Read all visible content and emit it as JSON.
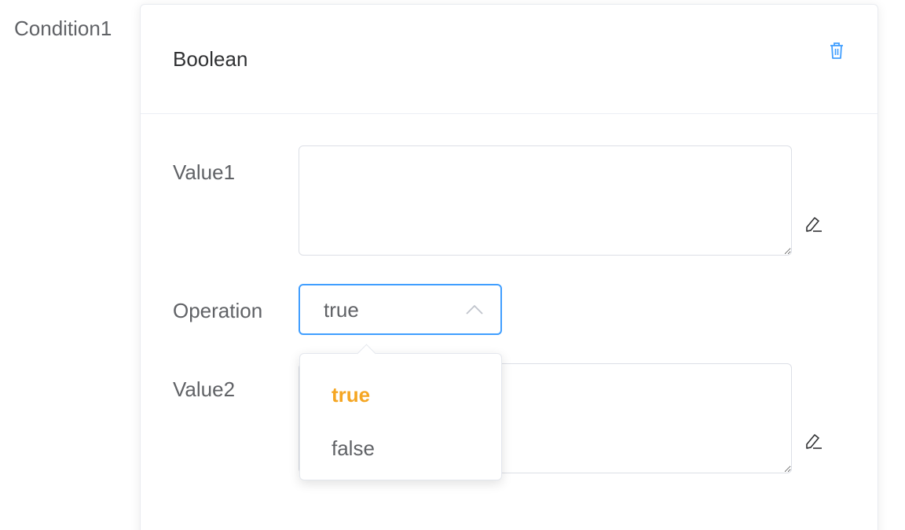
{
  "condition": {
    "label": "Condition1"
  },
  "card": {
    "title": "Boolean",
    "delete_icon": "trash-icon",
    "accent_color": "#409eff"
  },
  "form": {
    "value1": {
      "label": "Value1",
      "value": "",
      "edit_icon": "pencil-icon"
    },
    "operation": {
      "label": "Operation",
      "selected": "true",
      "options": [
        {
          "label": "true",
          "selected": true
        },
        {
          "label": "false",
          "selected": false
        }
      ],
      "highlight_color": "#f5a623"
    },
    "value2": {
      "label": "Value2",
      "value": "",
      "edit_icon": "pencil-icon"
    }
  }
}
